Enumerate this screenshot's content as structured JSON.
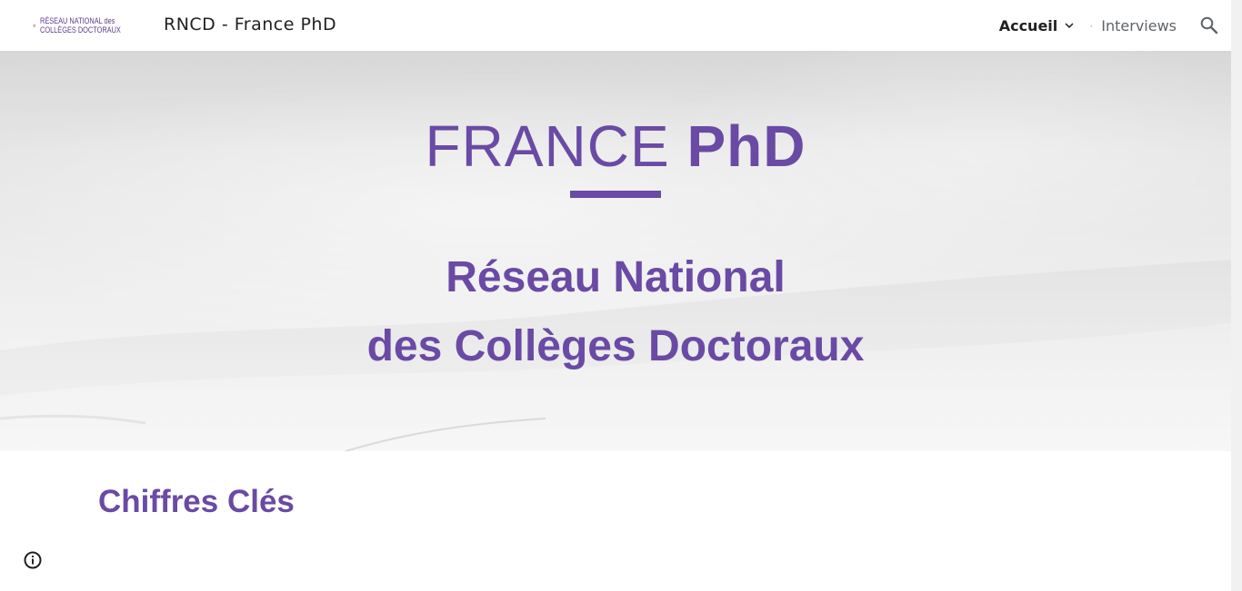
{
  "header": {
    "logo": {
      "line1": "RÉSEAU NATIONAL des",
      "line2": "COLLÈGES DOCTORAUX"
    },
    "site_title": "RNCD - France PhD",
    "nav": {
      "items": [
        {
          "label": "Accueil"
        },
        {
          "label": "Interviews"
        }
      ],
      "separator": "·"
    },
    "search_icon": "search-icon"
  },
  "hero": {
    "title_light": "FRANCE",
    "title_bold": "PhD",
    "subtitle_line1": "Réseau National",
    "subtitle_line2": "des Collèges Doctoraux",
    "accent_color": "#6a4aa5"
  },
  "main": {
    "section_heading": "Chiffres Clés"
  },
  "footer": {
    "info_icon": "info-icon"
  }
}
